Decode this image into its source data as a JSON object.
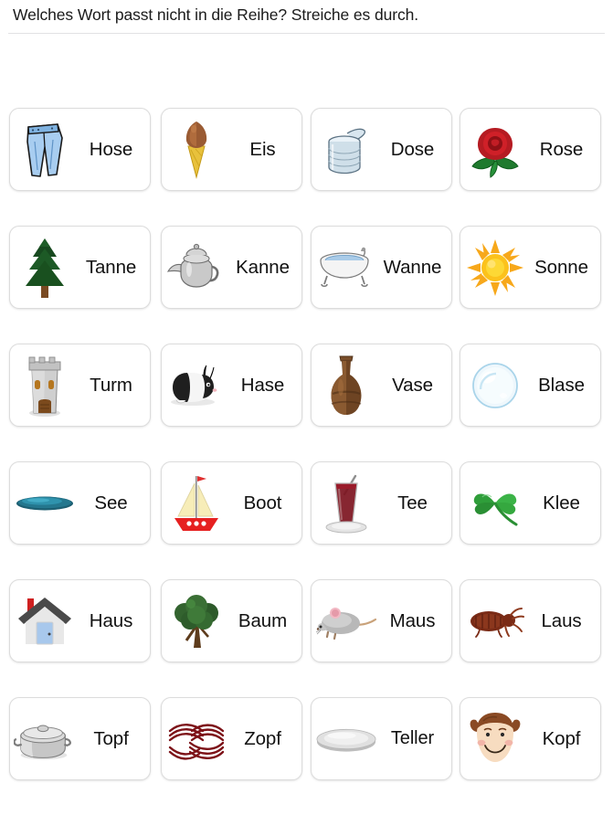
{
  "header": {
    "instruction": "Welches Wort passt nicht in die Reihe? Streiche es durch."
  },
  "grid": {
    "columns": 4,
    "rows": 6,
    "items": [
      [
        {
          "word": "Hose",
          "icon": "jeans-icon"
        },
        {
          "word": "Eis",
          "icon": "ice-cream-cone-icon"
        },
        {
          "word": "Dose",
          "icon": "tin-can-icon"
        },
        {
          "word": "Rose",
          "icon": "rose-icon"
        }
      ],
      [
        {
          "word": "Tanne",
          "icon": "fir-tree-icon"
        },
        {
          "word": "Kanne",
          "icon": "teapot-icon"
        },
        {
          "word": "Wanne",
          "icon": "bathtub-icon"
        },
        {
          "word": "Sonne",
          "icon": "sun-icon"
        }
      ],
      [
        {
          "word": "Turm",
          "icon": "tower-icon"
        },
        {
          "word": "Hase",
          "icon": "rabbit-icon"
        },
        {
          "word": "Vase",
          "icon": "vase-icon"
        },
        {
          "word": "Blase",
          "icon": "bubble-icon"
        }
      ],
      [
        {
          "word": "See",
          "icon": "lake-icon"
        },
        {
          "word": "Boot",
          "icon": "sailboat-icon"
        },
        {
          "word": "Tee",
          "icon": "tea-glass-icon"
        },
        {
          "word": "Klee",
          "icon": "clover-icon"
        }
      ],
      [
        {
          "word": "Haus",
          "icon": "house-icon"
        },
        {
          "word": "Baum",
          "icon": "deciduous-tree-icon"
        },
        {
          "word": "Maus",
          "icon": "mouse-icon"
        },
        {
          "word": "Laus",
          "icon": "louse-icon"
        }
      ],
      [
        {
          "word": "Topf",
          "icon": "cooking-pot-icon"
        },
        {
          "word": "Zopf",
          "icon": "braid-icon"
        },
        {
          "word": "Teller",
          "icon": "plate-icon"
        },
        {
          "word": "Kopf",
          "icon": "girl-head-icon"
        }
      ]
    ]
  },
  "colors": {
    "page_background": "#ffffff",
    "text": "#111111",
    "card_border": "#dcdcdc",
    "divider": "#e2e2e4"
  }
}
